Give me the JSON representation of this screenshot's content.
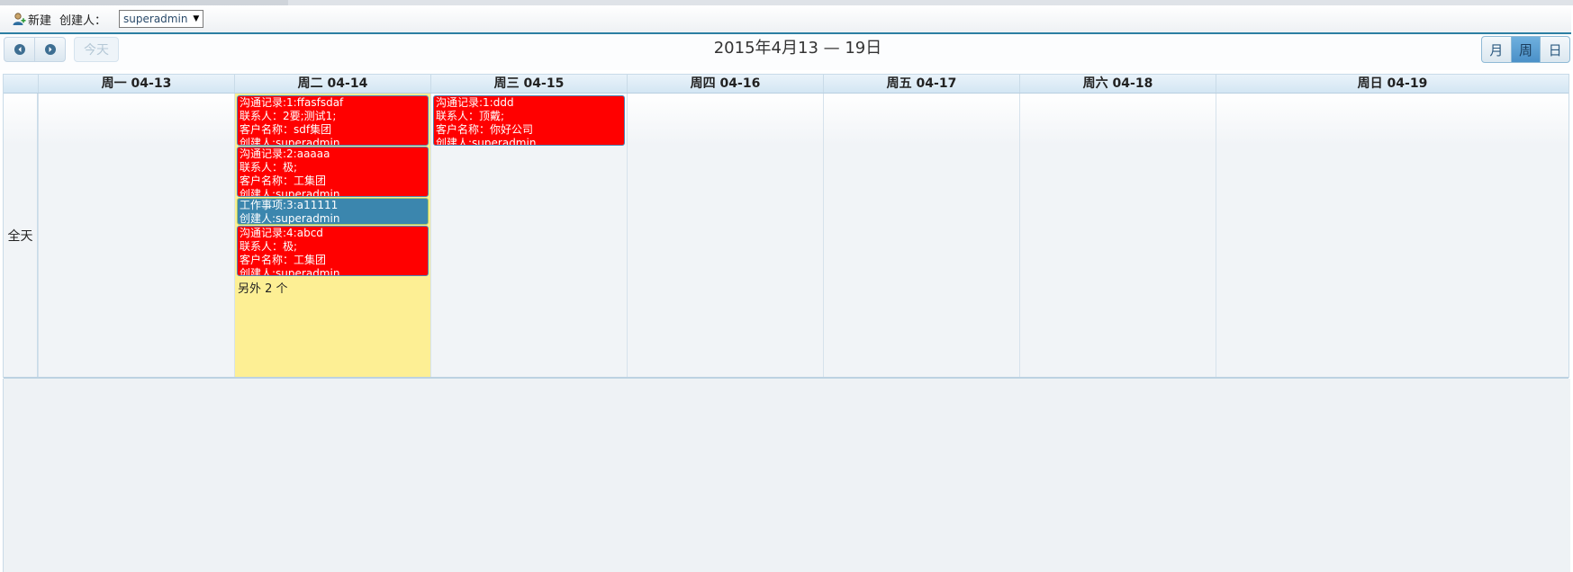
{
  "toolbar": {
    "new_label": "新建",
    "creator_label": "创建人：",
    "creator_selected": "superadmin"
  },
  "header": {
    "today_label": "今天",
    "range_title": "2015年4月13 — 19日",
    "views": {
      "month": "月",
      "week": "周",
      "day": "日"
    },
    "active_view": "week"
  },
  "grid": {
    "allday_label": "全天",
    "days": [
      {
        "label": "周一 04-13"
      },
      {
        "label": "周二 04-14"
      },
      {
        "label": "周三 04-15"
      },
      {
        "label": "周四 04-16"
      },
      {
        "label": "周五 04-17"
      },
      {
        "label": "周六 04-18"
      },
      {
        "label": "周日 04-19"
      }
    ],
    "events": {
      "tue": [
        {
          "type": "red",
          "lines": [
            "沟通记录:1:ffasfsdaf",
            "联系人：2要;测试1;",
            "客户名称：sdf集团",
            "创建人:superadmin"
          ]
        },
        {
          "type": "red",
          "lines": [
            "沟通记录:2:aaaaa",
            "联系人：极;",
            "客户名称：工集团",
            "创建人:superadmin"
          ]
        },
        {
          "type": "blue",
          "lines": [
            "工作事项:3:a11111",
            "创建人:superadmin"
          ]
        },
        {
          "type": "red",
          "lines": [
            "沟通记录:4:abcd",
            "联系人：极;",
            "客户名称：工集团",
            "创建人:superadmin"
          ]
        }
      ],
      "wed": [
        {
          "type": "red",
          "lines": [
            "沟通记录:1:ddd",
            "联系人：顶戴;",
            "客户名称：你好公司",
            "创建人:superadmin"
          ]
        }
      ],
      "tue_more": "另外 2 个"
    }
  },
  "colors": {
    "event_red": "#ff0000",
    "event_blue": "#3b86ae",
    "today_bg": "#fdef94",
    "accent": "#2c7fa3"
  },
  "icons": {
    "new": "user-add-icon",
    "prev": "chevron-left-icon",
    "next": "chevron-right-icon",
    "dropdown": "triangle-down-icon"
  }
}
